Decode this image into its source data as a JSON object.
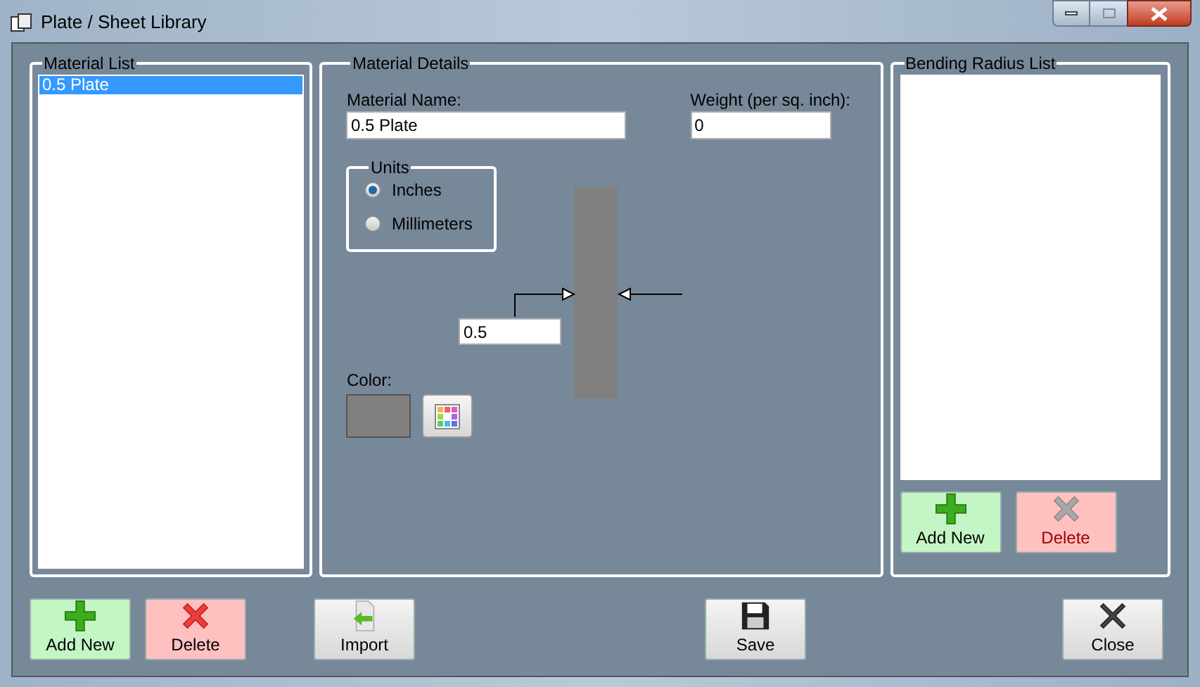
{
  "window": {
    "title": "Plate / Sheet Library"
  },
  "material_list": {
    "title": "Material List",
    "items": [
      {
        "label": "0.5 Plate",
        "selected": true
      }
    ]
  },
  "material_details": {
    "title": "Material Details",
    "name_label": "Material Name:",
    "name_value": "0.5 Plate",
    "weight_label": "Weight (per sq. inch):",
    "weight_value": "0",
    "units": {
      "title": "Units",
      "options": [
        {
          "label": "Inches",
          "selected": true
        },
        {
          "label": "Millimeters",
          "selected": false
        }
      ]
    },
    "thickness_value": "0.5",
    "color_label": "Color:",
    "color": "#808080"
  },
  "bending_radius_list": {
    "title": "Bending Radius List",
    "buttons": [
      {
        "label": "Add New",
        "kind": "add",
        "disabled": false
      },
      {
        "label": "Delete",
        "kind": "delete",
        "disabled": true
      }
    ]
  },
  "footer_buttons": [
    {
      "label": "Add New",
      "kind": "add",
      "disabled": false
    },
    {
      "label": "Delete",
      "kind": "delete",
      "disabled": false
    },
    {
      "label": "Import",
      "kind": "import",
      "disabled": false
    },
    {
      "label": "Save",
      "kind": "save",
      "disabled": false
    },
    {
      "label": "Close",
      "kind": "close",
      "disabled": false
    }
  ]
}
